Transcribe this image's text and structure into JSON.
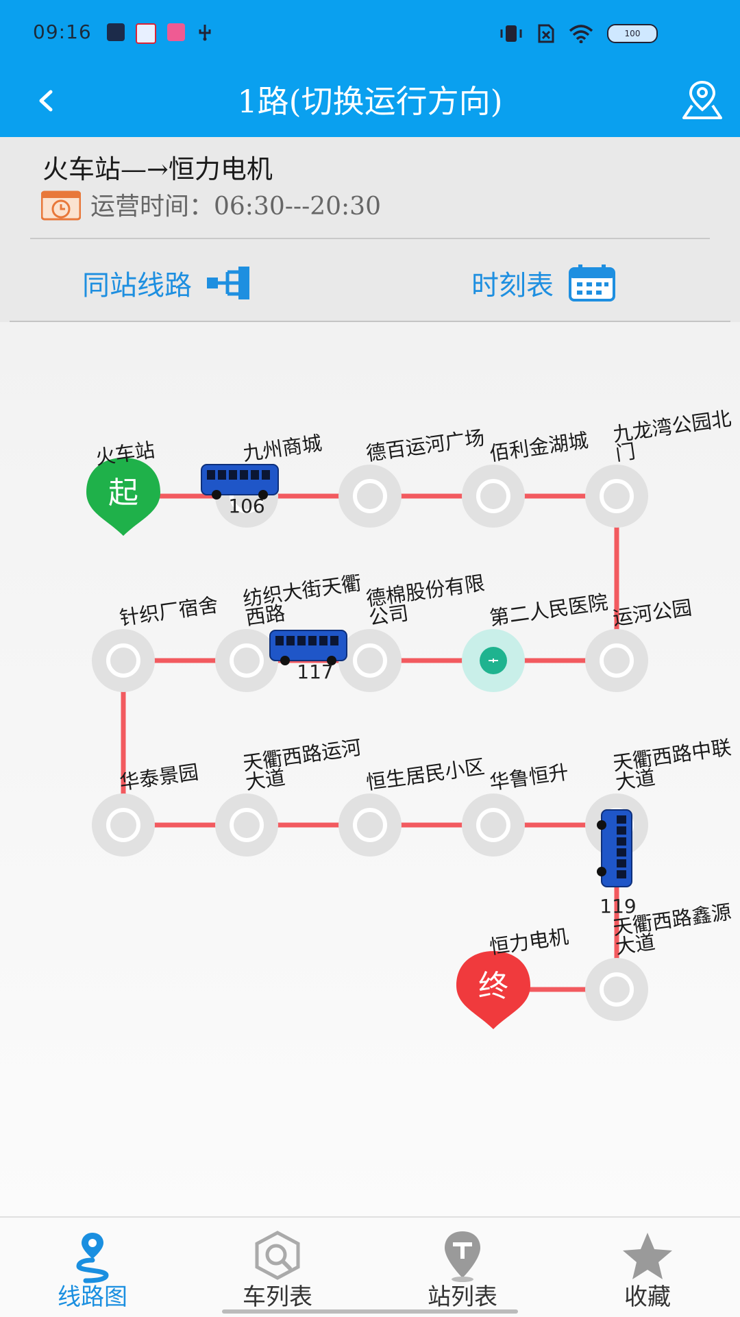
{
  "status_bar": {
    "time": "09:16",
    "battery": "100"
  },
  "header": {
    "title": "1路(切换运行方向)"
  },
  "route_info": {
    "name": "火车站—→恒力电机",
    "operating_time": "运营时间：06:30---20:30"
  },
  "actions": {
    "same_station_lines": "同站线路",
    "timetable": "时刻表"
  },
  "start_marker": "起",
  "end_marker": "终",
  "stations": [
    {
      "name": "火车站",
      "type": "start"
    },
    {
      "name": "九州商城"
    },
    {
      "name": "德百运河广场"
    },
    {
      "name": "佰利金湖城"
    },
    {
      "name": "九龙湾公园北门"
    },
    {
      "name": "运河公园"
    },
    {
      "name": "第二人民医院",
      "current": true
    },
    {
      "name": "德棉股份有限公司"
    },
    {
      "name": "纺织大街天衢西路"
    },
    {
      "name": "针织厂宿舍"
    },
    {
      "name": "华泰景园"
    },
    {
      "name": "天衢西路运河大道"
    },
    {
      "name": "恒生居民小区"
    },
    {
      "name": "华鲁恒升"
    },
    {
      "name": "天衢西路中联大道"
    },
    {
      "name": "天衢西路鑫源大道"
    },
    {
      "name": "恒力电机",
      "type": "end"
    }
  ],
  "buses": [
    {
      "id": "106",
      "between": [
        1,
        1
      ]
    },
    {
      "id": "117",
      "between": [
        7,
        8
      ]
    },
    {
      "id": "119",
      "between": [
        14,
        15
      ]
    }
  ],
  "colors": {
    "accent": "#0aa0ef",
    "route_line": "#f25a5f",
    "start": "#1fb14a",
    "end": "#f03a3d"
  },
  "bottom_nav": [
    {
      "label": "线路图",
      "icon": "route-map-icon",
      "active": true
    },
    {
      "label": "车列表",
      "icon": "bus-list-icon"
    },
    {
      "label": "站列表",
      "icon": "station-list-icon"
    },
    {
      "label": "收藏",
      "icon": "star-icon"
    }
  ]
}
